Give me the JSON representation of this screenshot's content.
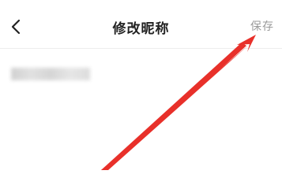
{
  "header": {
    "title": "修改昵称",
    "save_label": "保存",
    "back_icon": "chevron-left-icon"
  },
  "nickname_field": {
    "value": ""
  },
  "colors": {
    "title": "#222222",
    "save_text": "#9a9a9a",
    "annotation_arrow": "#e8302a"
  }
}
